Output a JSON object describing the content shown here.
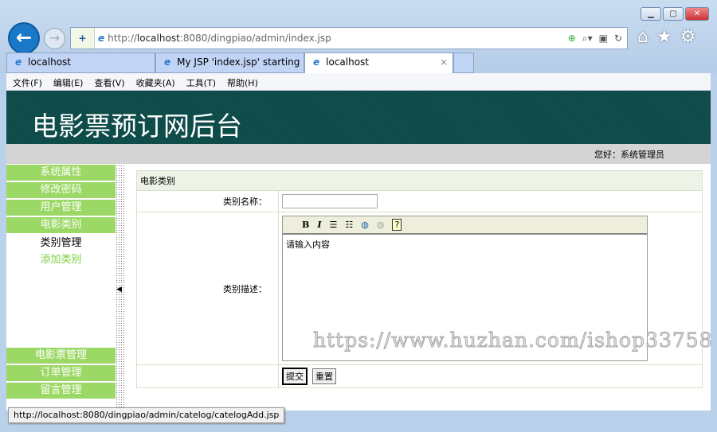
{
  "browser": {
    "url_prefix": "http://",
    "url_host": "localhost",
    "url_rest": ":8080/dingpiao/admin/index.jsp",
    "tabs": [
      {
        "label": "localhost"
      },
      {
        "label": "My JSP 'index.jsp' starting ..."
      },
      {
        "label": "localhost"
      }
    ],
    "menu": [
      "文件(F)",
      "编辑(E)",
      "查看(V)",
      "收藏夹(A)",
      "工具(T)",
      "帮助(H)"
    ],
    "status_url": "http://localhost:8080/dingpiao/admin/catelog/catelogAdd.jsp"
  },
  "header": {
    "title": "电影票预订网后台",
    "greeting": "您好：系统管理员"
  },
  "sidebar": {
    "top": [
      "系统属性",
      "修改密码",
      "用户管理",
      "电影类别"
    ],
    "sub": [
      "类别管理",
      "添加类别"
    ],
    "bottom": [
      "电影票管理",
      "订单管理",
      "留言管理"
    ]
  },
  "form": {
    "caption": "电影类别",
    "name_label": "类别名称：",
    "name_value": "",
    "desc_label": "类别描述：",
    "editor_text": "请输入内容",
    "submit": "提交",
    "reset": "重置"
  },
  "watermark": "https://www.huzhan.com/ishop33758"
}
